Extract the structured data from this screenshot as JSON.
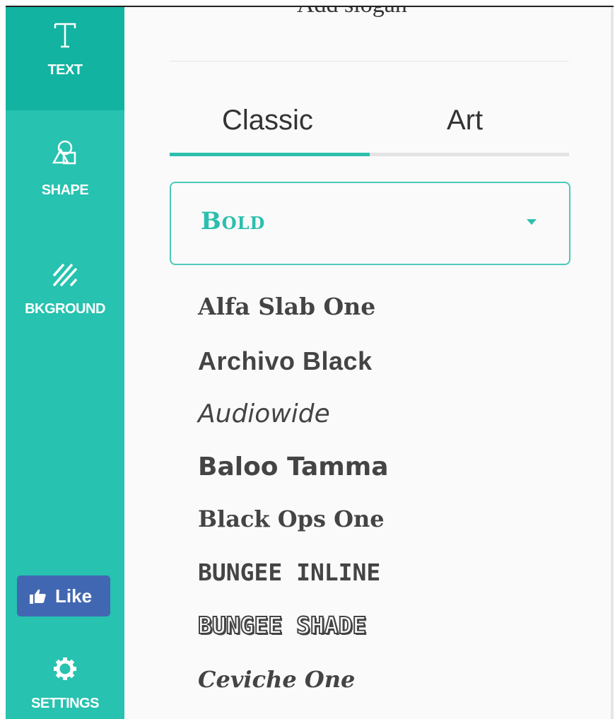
{
  "sidebar": {
    "items": [
      {
        "label": "TEXT",
        "icon": "text-icon"
      },
      {
        "label": "SHAPE",
        "icon": "shape-icon"
      },
      {
        "label": "BKGROUND",
        "icon": "background-stripes-icon"
      }
    ],
    "like_label": "Like",
    "settings_label": "SETTINGS"
  },
  "editor": {
    "slogan_text": "Add slogan",
    "tabs": [
      {
        "label": "Classic",
        "active": true
      },
      {
        "label": "Art",
        "active": false
      }
    ],
    "category_value": "Bold",
    "fonts": [
      "Alfa Slab One",
      "Archivo Black",
      "Audiowide",
      "Baloo Tamma",
      "Black Ops One",
      "Bungee Inline",
      "Bungee Shade",
      "Ceviche One"
    ]
  },
  "colors": {
    "sidebar": "#27c2b0",
    "sidebar_active": "#13b3a1",
    "accent": "#2dbfad",
    "like_button": "#4267b2"
  }
}
